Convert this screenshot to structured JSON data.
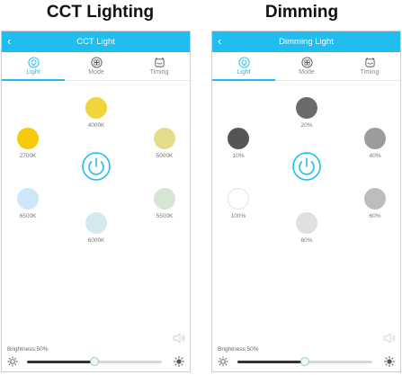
{
  "captions": {
    "left": "CCT Lighting",
    "right": "Dimming"
  },
  "accent": "#1fbdf0",
  "cct": {
    "title": "CCT Light",
    "back_icon": "chevron-left-icon",
    "tabs": [
      {
        "label": "Light",
        "icon": "bulb-icon",
        "active": true
      },
      {
        "label": "Mode",
        "icon": "mode-icon",
        "active": false
      },
      {
        "label": "Timing",
        "icon": "alarm-clock-icon",
        "active": false
      }
    ],
    "presets": [
      {
        "label": "4000K",
        "color": "#f1d43a"
      },
      {
        "label": "2700K",
        "color": "#f7c90b"
      },
      {
        "label": "5000K",
        "color": "#e4dc88"
      },
      {
        "label": "6500K",
        "color": "#cde6f8"
      },
      {
        "label": "5500K",
        "color": "#d5e6d3"
      },
      {
        "label": "6000K",
        "color": "#d3e9f0"
      }
    ],
    "brightness_label": "Brightness:50%",
    "brightness_value": 0.5
  },
  "dim": {
    "title": "Dimming Light",
    "back_icon": "chevron-left-icon",
    "tabs": [
      {
        "label": "Light",
        "icon": "bulb-icon",
        "active": true
      },
      {
        "label": "Mode",
        "icon": "mode-icon",
        "active": false
      },
      {
        "label": "Timing",
        "icon": "alarm-clock-icon",
        "active": false
      }
    ],
    "presets": [
      {
        "label": "20%",
        "color": "#6b6b6b"
      },
      {
        "label": "10%",
        "color": "#555555"
      },
      {
        "label": "40%",
        "color": "#9c9c9c"
      },
      {
        "label": "100%",
        "color": "#ffffff"
      },
      {
        "label": "60%",
        "color": "#bdbdbd"
      },
      {
        "label": "80%",
        "color": "#e0e0e0"
      }
    ],
    "brightness_label": "Brightness:50%",
    "brightness_value": 0.5
  }
}
